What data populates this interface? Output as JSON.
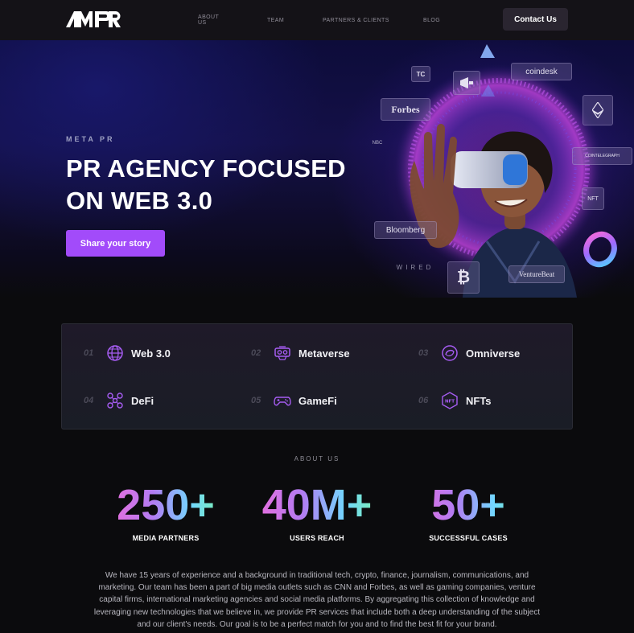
{
  "nav": {
    "logo_text": "MPR",
    "links": [
      "ABOUT US",
      "TEAM",
      "PARTNERS & CLIENTS",
      "BLOG"
    ],
    "contact_label": "Contact Us"
  },
  "hero": {
    "kicker": "META PR",
    "title_line1": "PR AGENCY FOCUSED",
    "title_line2": "ON WEB 3.0",
    "cta_label": "Share your story",
    "media_badges": [
      "coindesk",
      "Forbes",
      "Bloomberg",
      "VentureBeat",
      "COINTELEGRAPH",
      "TC",
      "WIRED",
      "NBC",
      "NFT"
    ]
  },
  "topics": [
    {
      "num": "01",
      "label": "Web 3.0",
      "icon": "globe-icon"
    },
    {
      "num": "02",
      "label": "Metaverse",
      "icon": "vr-headset-icon"
    },
    {
      "num": "03",
      "label": "Omniverse",
      "icon": "orbit-icon"
    },
    {
      "num": "04",
      "label": "DeFi",
      "icon": "network-icon"
    },
    {
      "num": "05",
      "label": "GameFi",
      "icon": "gamepad-icon"
    },
    {
      "num": "06",
      "label": "NFTs",
      "icon": "nft-hexagon-icon"
    }
  ],
  "about": {
    "kicker": "ABOUT US",
    "stats": [
      {
        "value": "250+",
        "label": "MEDIA PARTNERS"
      },
      {
        "value": "40M+",
        "label": "USERS REACH"
      },
      {
        "value": "50+",
        "label": "SUCCESSFUL CASES"
      }
    ],
    "text": "We have 15 years of experience and a background in traditional tech, crypto, finance, journalism, communications, and marketing. Our team has been a part of big media outlets such as CNN and Forbes, as well as gaming companies, venture capital firms, international marketing agencies and social media platforms. By aggregating this collection of knowledge and leveraging new technologies that we believe in, we provide PR services that include both a deep understanding of the subject and our client's needs. Our goal is to be a perfect match for you and to find the best fit for your brand."
  },
  "colors": {
    "accent": "#a24bfa",
    "background": "#0b0b0d",
    "nav_bg": "#141217"
  }
}
